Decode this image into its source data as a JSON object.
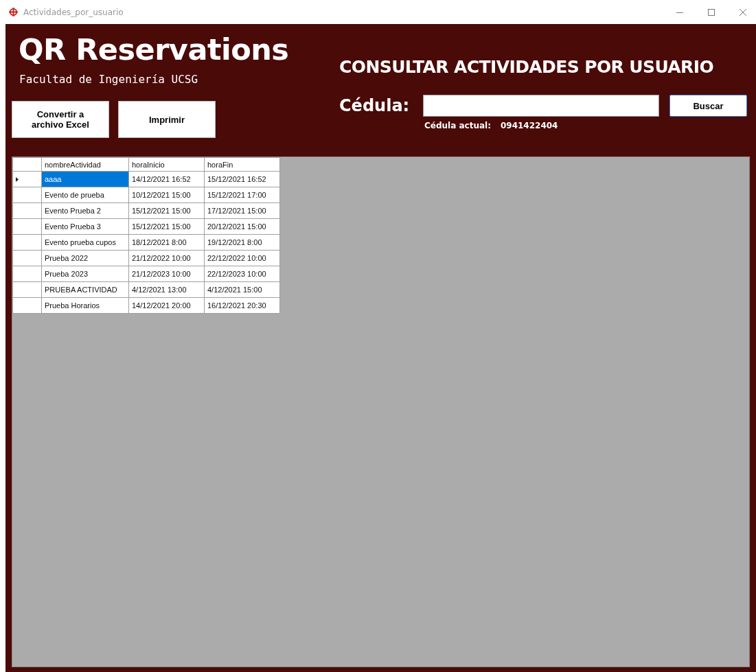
{
  "window": {
    "title": "Actividades_por_usuario"
  },
  "app_title": "QR Reservations",
  "subtitle": "Facultad de Ingeniería UCSG",
  "page_title": "CONSULTAR ACTIVIDADES POR USUARIO",
  "buttons": [
    {
      "label": "Convertir a archivo Excel"
    },
    {
      "label": "Imprimir"
    }
  ],
  "search": {
    "label": "Cédula:",
    "button": "Buscar"
  },
  "current": {
    "label": "Cédula actual:",
    "value": "0941422404"
  },
  "table": {
    "columns": [
      "nombreActividad",
      "horaInicio",
      "horaFin"
    ],
    "rows": [
      {
        "selected": true,
        "cells": [
          "aaaa",
          "14/12/2021 16:52",
          "15/12/2021 16:52"
        ]
      },
      {
        "selected": false,
        "cells": [
          "Evento de prueba",
          "10/12/2021 15:00",
          "15/12/2021 17:00"
        ]
      },
      {
        "selected": false,
        "cells": [
          "Evento Prueba 2",
          "15/12/2021 15:00",
          "17/12/2021 15:00"
        ]
      },
      {
        "selected": false,
        "cells": [
          "Evento Prueba 3",
          "15/12/2021 15:00",
          "20/12/2021 15:00"
        ]
      },
      {
        "selected": false,
        "cells": [
          "Evento prueba cupos",
          "18/12/2021 8:00",
          "19/12/2021 8:00"
        ]
      },
      {
        "selected": false,
        "cells": [
          "Prueba 2022",
          "21/12/2022 10:00",
          "22/12/2022 10:00"
        ]
      },
      {
        "selected": false,
        "cells": [
          "Prueba 2023",
          "21/12/2023 10:00",
          "22/12/2023 10:00"
        ]
      },
      {
        "selected": false,
        "cells": [
          "PRUEBA ACTIVIDAD",
          "4/12/2021 13:00",
          "4/12/2021 15:00"
        ]
      },
      {
        "selected": false,
        "cells": [
          "Prueba Horarios",
          "14/12/2021 20:00",
          "16/12/2021 20:30"
        ]
      }
    ]
  }
}
